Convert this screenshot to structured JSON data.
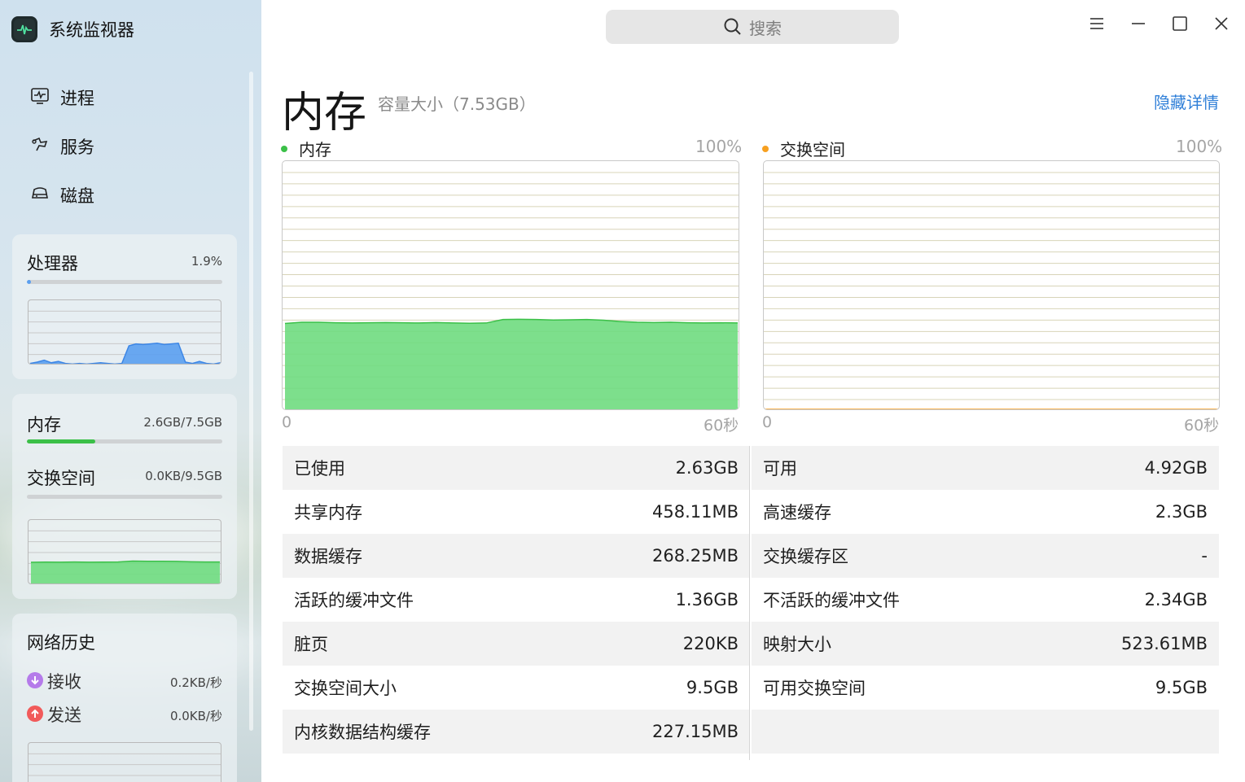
{
  "app": {
    "title": "系统监视器",
    "search_placeholder": "搜索"
  },
  "nav": [
    {
      "label": "进程",
      "icon": "process-monitor-icon"
    },
    {
      "label": "服务",
      "icon": "service-icon"
    },
    {
      "label": "磁盘",
      "icon": "disk-icon"
    }
  ],
  "sidebar": {
    "cpu": {
      "title": "处理器",
      "value": "1.9%",
      "usage_fraction": 0.019
    },
    "memory": {
      "title": "内存",
      "value": "2.6GB/7.5GB",
      "usage_fraction": 0.35
    },
    "swap": {
      "title": "交换空间",
      "value": "0.0KB/9.5GB",
      "usage_fraction": 0.0
    },
    "network": {
      "title": "网络历史",
      "recv_label": "接收",
      "recv_value": "0.2KB/秒",
      "send_label": "发送",
      "send_value": "0.0KB/秒"
    }
  },
  "main": {
    "title": "内存",
    "capacity": "容量大小（7.53GB）",
    "hide_details": "隐藏详情",
    "memory_chart": {
      "label": "内存",
      "max": "100%",
      "x_start": "0",
      "x_end": "60秒"
    },
    "swap_chart": {
      "label": "交换空间",
      "max": "100%",
      "x_start": "0",
      "x_end": "60秒"
    }
  },
  "details_left": [
    {
      "label": "已使用",
      "value": "2.63GB"
    },
    {
      "label": "共享内存",
      "value": "458.11MB"
    },
    {
      "label": "数据缓存",
      "value": "268.25MB"
    },
    {
      "label": "活跃的缓冲文件",
      "value": "1.36GB"
    },
    {
      "label": "脏页",
      "value": "220KB"
    },
    {
      "label": "交换空间大小",
      "value": "9.5GB"
    },
    {
      "label": "内核数据结构缓存",
      "value": "227.15MB"
    }
  ],
  "details_right": [
    {
      "label": "可用",
      "value": "4.92GB"
    },
    {
      "label": "高速缓存",
      "value": "2.3GB"
    },
    {
      "label": "交换缓存区",
      "value": "-"
    },
    {
      "label": "不活跃的缓冲文件",
      "value": "2.34GB"
    },
    {
      "label": "映射大小",
      "value": "523.61MB"
    },
    {
      "label": "可用交换空间",
      "value": "9.5GB"
    }
  ],
  "colors": {
    "memory_green": "#6fdc80",
    "swap_orange": "#f7a020",
    "cpu_blue": "#5a9ff0",
    "link_blue": "#2f7fd8",
    "recv_purple": "#b57bea",
    "send_red": "#f15a5a"
  },
  "chart_data": [
    {
      "type": "area",
      "name": "memory-usage-history",
      "ylim": [
        0,
        100
      ],
      "x_range_seconds": [
        0,
        60
      ],
      "values": [
        35,
        35.5,
        35.5,
        35.3,
        35.2,
        35.3,
        35.4,
        35.3,
        35.2,
        35.4,
        35.2,
        35.1,
        35.2,
        36.6,
        36.7,
        36.6,
        36.4,
        36.5,
        36.6,
        36.3,
        35.8,
        35.5,
        35.4,
        35.5,
        35.3,
        35.2,
        35.3,
        35.2
      ]
    },
    {
      "type": "area",
      "name": "swap-usage-history",
      "ylim": [
        0,
        100
      ],
      "x_range_seconds": [
        0,
        60
      ],
      "values": [
        0,
        0,
        0,
        0,
        0,
        0,
        0,
        0,
        0,
        0
      ]
    },
    {
      "type": "area",
      "name": "cpu-usage-mini",
      "ylim": [
        0,
        100
      ],
      "values": [
        3,
        5,
        8,
        4,
        6,
        3,
        2,
        3,
        2,
        3,
        4,
        3,
        2,
        3,
        30,
        33,
        32,
        33,
        34,
        32,
        33,
        34,
        5,
        3,
        6,
        3,
        2,
        4
      ]
    },
    {
      "type": "area",
      "name": "memory-usage-mini",
      "ylim": [
        0,
        100
      ],
      "values": [
        35,
        35.3,
        35.2,
        35.4,
        35.2,
        35.3,
        35.5,
        36.8,
        36.6,
        36.5,
        36.4,
        35.8,
        35.5,
        35.4
      ]
    }
  ]
}
